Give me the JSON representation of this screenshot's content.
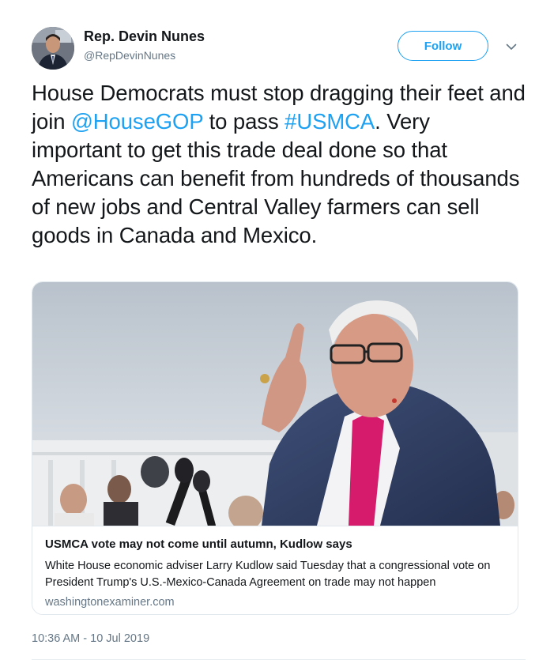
{
  "author": {
    "display_name": "Rep. Devin Nunes",
    "handle": "@RepDevinNunes"
  },
  "follow_button": {
    "label": "Follow"
  },
  "tweet": {
    "text_parts": [
      "House Democrats must stop dragging their feet and join ",
      "@HouseGOP",
      " to pass ",
      "#USMCA",
      ". Very important to get this trade deal done so that Americans can benefit from hundreds of thousands of new jobs and Central Valley farmers can sell goods in Canada and Mexico."
    ],
    "timestamp": "10:36 AM - 10 Jul 2019"
  },
  "card": {
    "title": "USMCA vote may not come until autumn, Kudlow says",
    "description": "White House economic adviser Larry Kudlow said Tuesday that a congressional vote on President Trump's U.S.-Mexico-Canada Agreement on trade may not happen",
    "domain": "washingtonexaminer.com"
  },
  "colors": {
    "link": "#1da1f2",
    "secondary_text": "#657786",
    "border": "#e1e8ed"
  },
  "icons": [
    "avatar",
    "chevron-down-icon"
  ]
}
